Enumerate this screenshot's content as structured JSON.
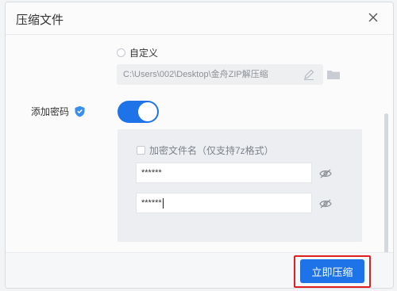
{
  "dialog": {
    "title": "压缩文件",
    "close_icon": "close-icon"
  },
  "custom_path": {
    "radio_label": "自定义",
    "path_value": "C:\\Users\\002\\Desktop\\金舟ZIP解压缩",
    "edit_icon": "edit-icon",
    "folder_icon": "folder-icon"
  },
  "password": {
    "label": "添加密码",
    "badge_icon": "shield-icon",
    "toggle_on": true,
    "accent": "#1f73e8",
    "encrypt_filename_label": "加密文件名（仅支持7z格式）",
    "password_value": "******",
    "confirm_value": "******",
    "eye_icon": "eye-icon"
  },
  "footer": {
    "compress_button": "立即压缩",
    "highlight_color": "#e02020"
  }
}
